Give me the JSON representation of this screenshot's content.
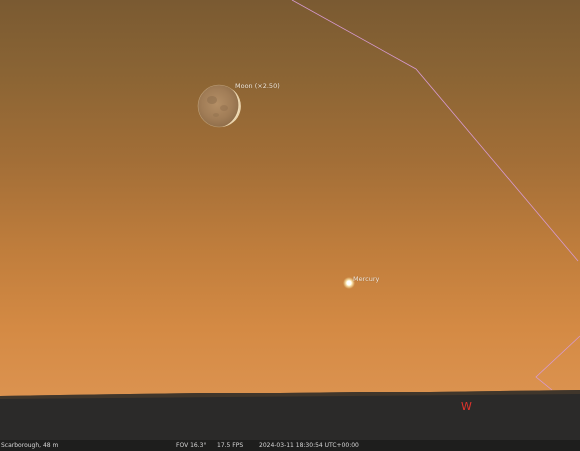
{
  "sky": {
    "objects": {
      "moon": {
        "label": "Moon (×2.50)"
      },
      "mercury": {
        "label": "Mercury"
      }
    },
    "cardinal": {
      "west": "W"
    }
  },
  "status_bar": {
    "location": "Scarborough, 48 m",
    "fov": "FOV 16.3°",
    "fps": "17.5 FPS",
    "datetime": "2024-03-11 18:30:54 UTC+00:00"
  },
  "colors": {
    "ecliptic_line": "#d79ad0",
    "cardinal_text": "#e0332c",
    "label_text": "#f3e9dc"
  }
}
